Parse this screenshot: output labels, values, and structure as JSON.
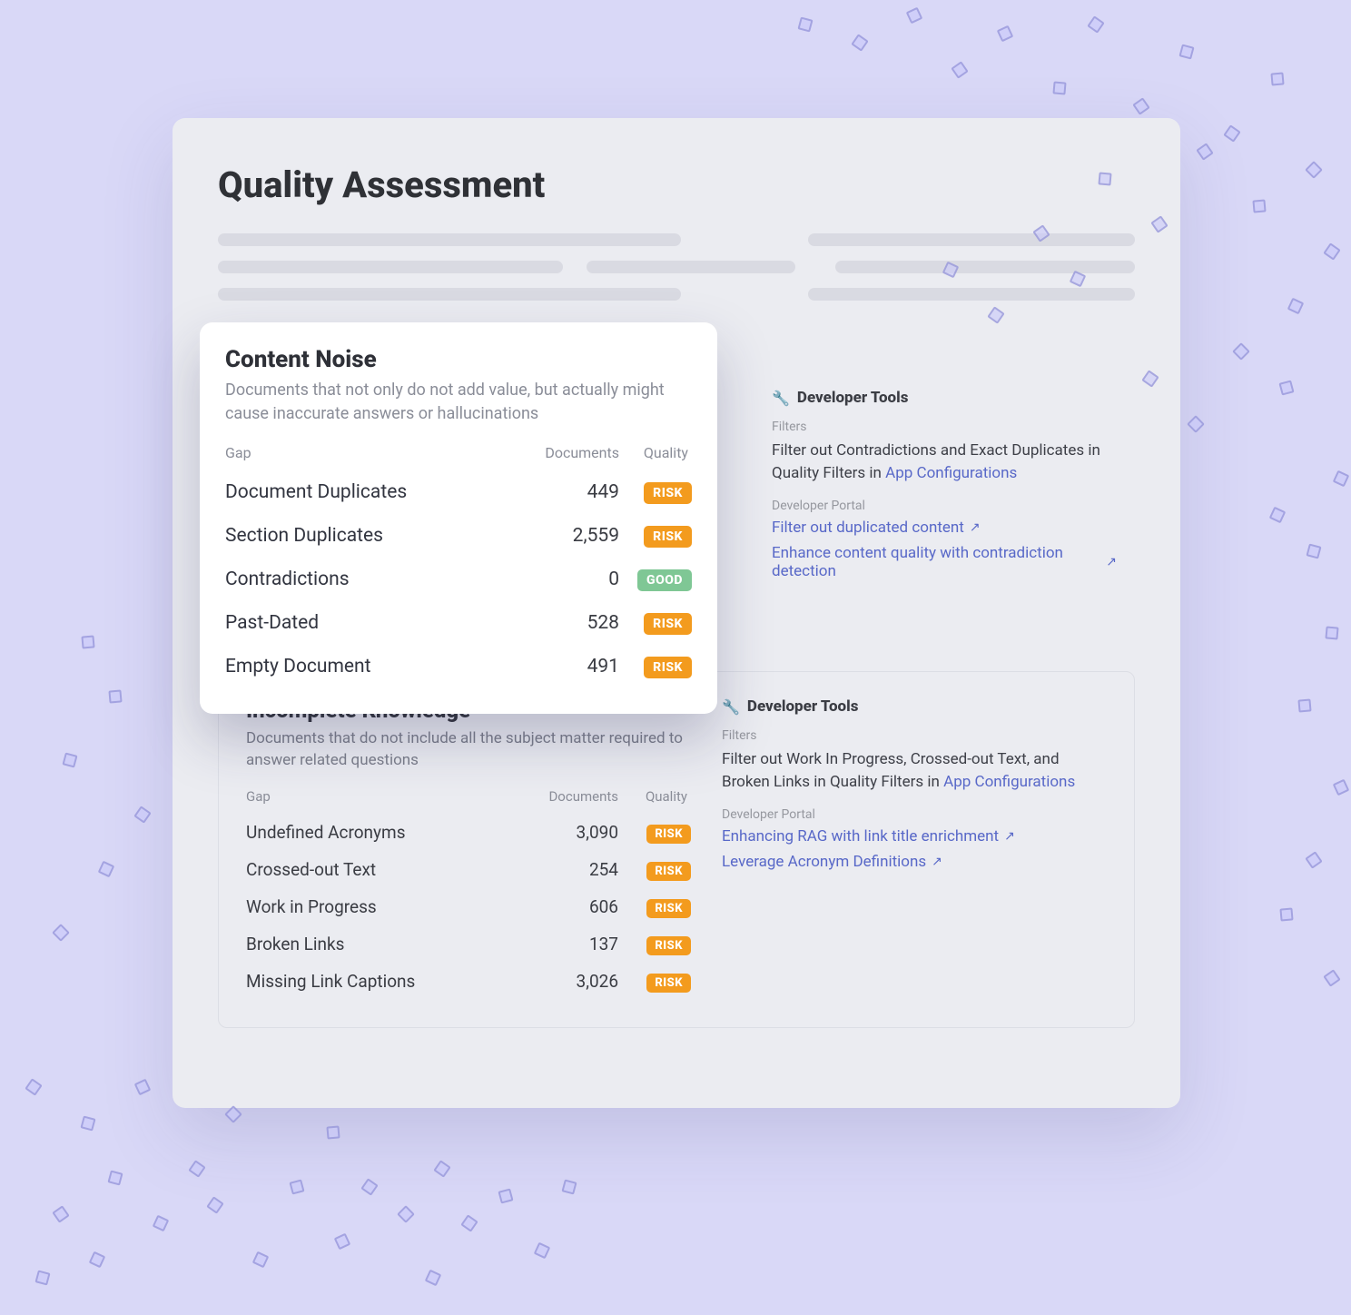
{
  "page": {
    "title": "Quality Assessment"
  },
  "content_noise": {
    "title": "Content Noise",
    "subtitle": "Documents that not only do not add value, but actually might cause inaccurate answers or hallucinations",
    "columns": {
      "gap": "Gap",
      "documents": "Documents",
      "quality": "Quality"
    },
    "rows": [
      {
        "gap": "Document Duplicates",
        "documents": "449",
        "quality": "RISK"
      },
      {
        "gap": "Section Duplicates",
        "documents": "2,559",
        "quality": "RISK"
      },
      {
        "gap": "Contradictions",
        "documents": "0",
        "quality": "GOOD"
      },
      {
        "gap": "Past-Dated",
        "documents": "528",
        "quality": "RISK"
      },
      {
        "gap": "Empty Document",
        "documents": "491",
        "quality": "RISK"
      }
    ],
    "dev": {
      "heading": "Developer Tools",
      "filters_label": "Filters",
      "filters_text_pre": "Filter out Contradictions and Exact Duplicates in Quality Filters in ",
      "filters_link": "App Configurations",
      "portal_label": "Developer Portal",
      "links": [
        "Filter out duplicated content",
        "Enhance content quality with contradiction detection"
      ]
    }
  },
  "incomplete": {
    "title": "Incomplete Knowledge",
    "subtitle": "Documents that do not include all the subject matter required to answer related questions",
    "columns": {
      "gap": "Gap",
      "documents": "Documents",
      "quality": "Quality"
    },
    "rows": [
      {
        "gap": "Undefined Acronyms",
        "documents": "3,090",
        "quality": "RISK"
      },
      {
        "gap": "Crossed-out Text",
        "documents": "254",
        "quality": "RISK"
      },
      {
        "gap": "Work in Progress",
        "documents": "606",
        "quality": "RISK"
      },
      {
        "gap": "Broken Links",
        "documents": "137",
        "quality": "RISK"
      },
      {
        "gap": "Missing Link Captions",
        "documents": "3,026",
        "quality": "RISK"
      }
    ],
    "dev": {
      "heading": "Developer Tools",
      "filters_label": "Filters",
      "filters_text_pre": "Filter out Work In Progress, Crossed-out Text, and Broken Links in Quality Filters in ",
      "filters_link": "App Configurations",
      "portal_label": "Developer Portal",
      "links": [
        "Enhancing RAG with link title enrichment",
        "Leverage Acronym Definitions"
      ]
    }
  },
  "colors": {
    "risk": "#f39b1e",
    "good": "#7fc795",
    "link": "#5868c8"
  }
}
